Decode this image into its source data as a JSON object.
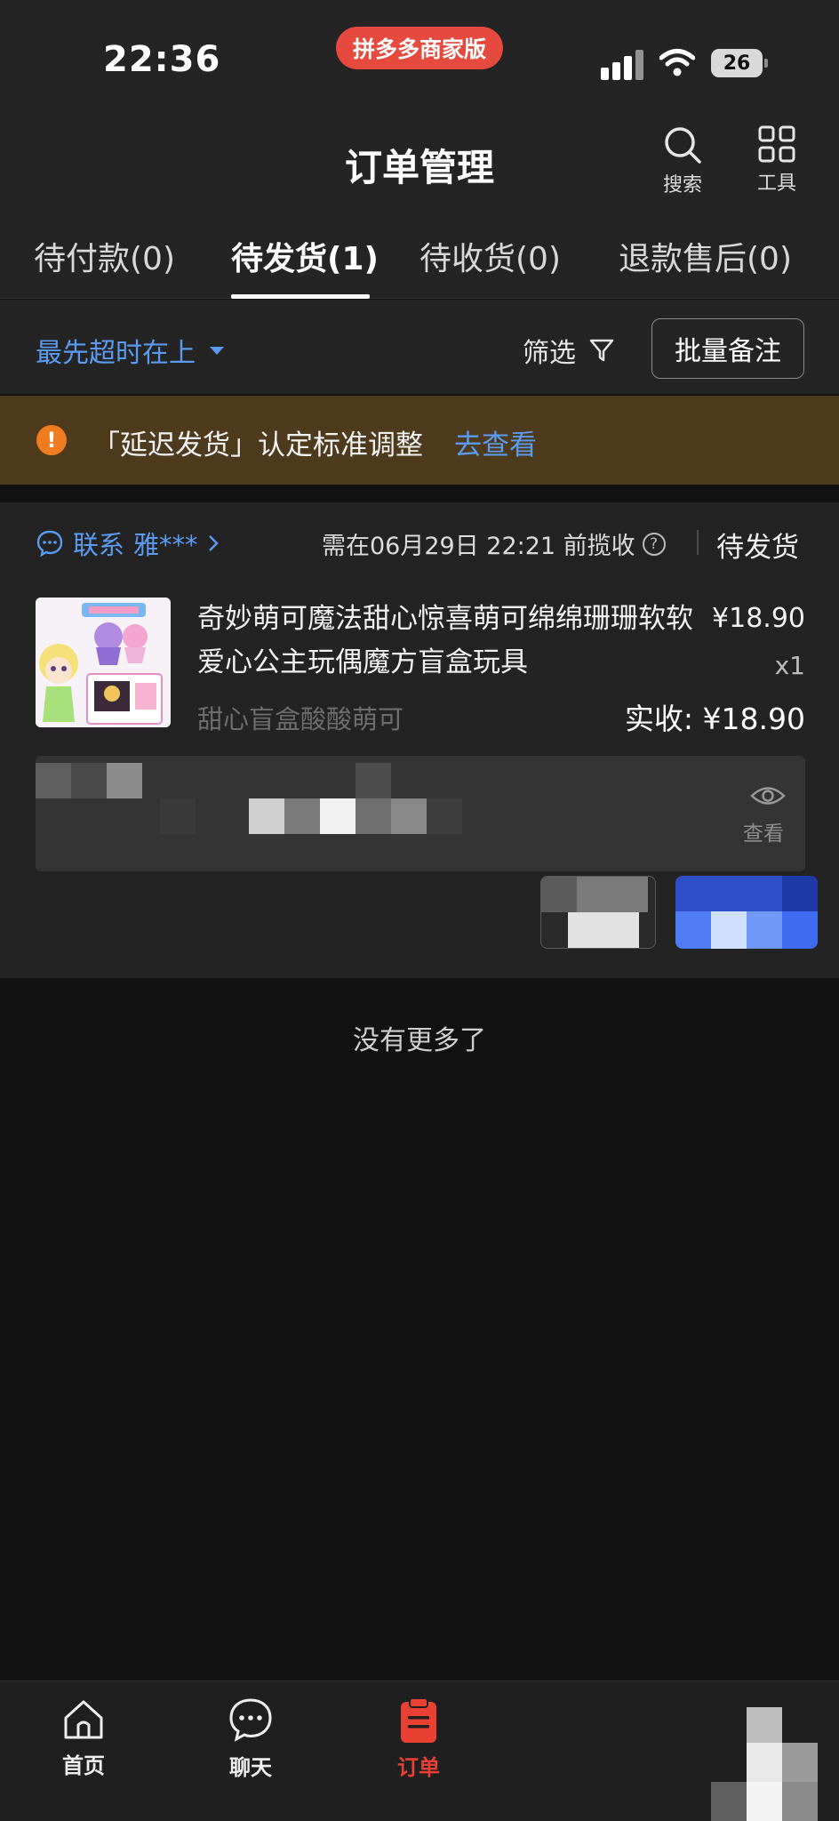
{
  "status_bar": {
    "time": "22:36",
    "app_badge": "拼多多商家版",
    "battery": "26"
  },
  "header": {
    "title": "订单管理",
    "search_label": "搜索",
    "tools_label": "工具"
  },
  "tabs": [
    {
      "label": "待付款(0)"
    },
    {
      "label": "待发货(1)",
      "active": true
    },
    {
      "label": "待收货(0)"
    },
    {
      "label": "退款售后(0)"
    }
  ],
  "filter_row": {
    "sort_label": "最先超时在上",
    "filter_label": "筛选",
    "batch_note_label": "批量备注"
  },
  "notice": {
    "text": "「延迟发货」认定标准调整",
    "link": "去查看"
  },
  "order": {
    "contact_label": "联系",
    "buyer": "雅***",
    "deadline": "需在06月29日 22:21 前揽收",
    "status": "待发货",
    "product_name": "奇妙萌可魔法甜心惊喜萌可绵绵珊珊软软爱心公主玩偶魔方盲盒玩具",
    "spec": "甜心盲盒酸酸萌可",
    "price": "¥18.90",
    "quantity": "x1",
    "actual_label": "实收:",
    "actual_amount": "¥18.90",
    "view_label": "查看"
  },
  "list_end": "没有更多了",
  "bottom_nav": [
    {
      "label": "首页",
      "icon": "home-icon"
    },
    {
      "label": "聊天",
      "icon": "chat-icon"
    },
    {
      "label": "订单",
      "icon": "order-icon",
      "active": true
    }
  ],
  "colors": {
    "accent_blue": "#5b9cf2",
    "brand_red": "#e84133",
    "notice_bg": "#4e3b1d",
    "notice_icon": "#ef7d1f"
  }
}
